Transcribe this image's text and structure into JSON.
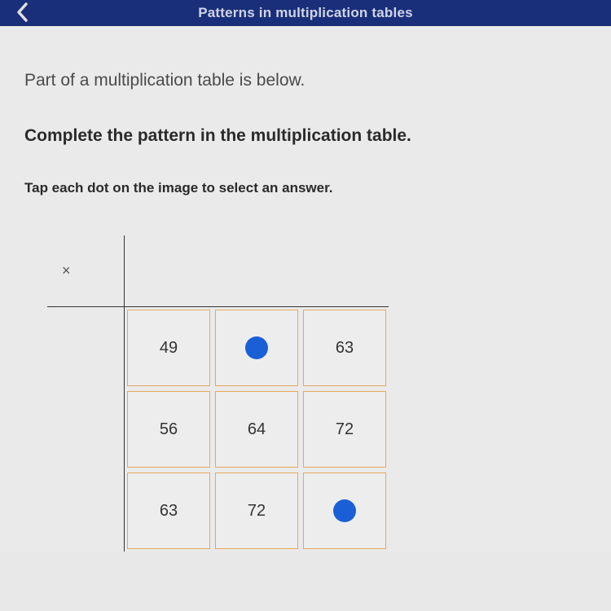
{
  "header": {
    "title": "Patterns in multiplication tables"
  },
  "content": {
    "intro": "Part of a multiplication table is below.",
    "prompt": "Complete the pattern in the multiplication table.",
    "hint": "Tap each dot on the image to select an answer."
  },
  "table": {
    "operator": "×",
    "cells": [
      [
        "49",
        null,
        "63"
      ],
      [
        "56",
        "64",
        "72"
      ],
      [
        "63",
        "72",
        null
      ]
    ]
  }
}
